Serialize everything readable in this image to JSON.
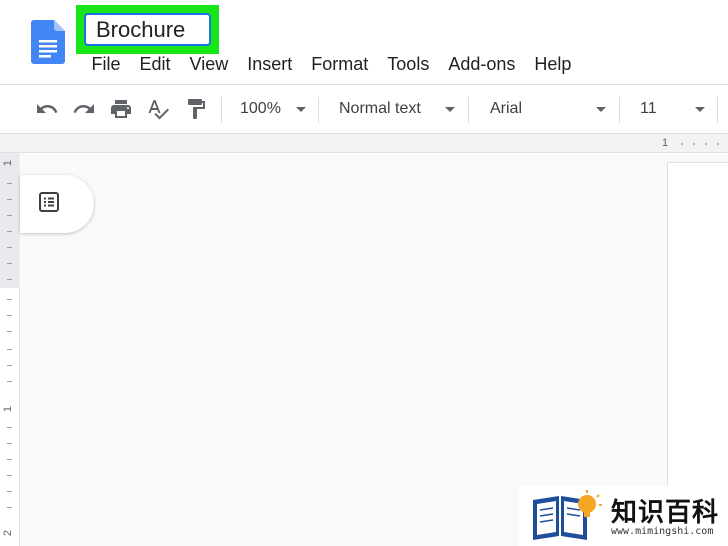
{
  "document": {
    "title": "Brochure"
  },
  "menu": {
    "items": [
      "File",
      "Edit",
      "View",
      "Insert",
      "Format",
      "Tools",
      "Add-ons",
      "Help"
    ]
  },
  "toolbar": {
    "zoom": "100%",
    "style": "Normal text",
    "font": "Arial",
    "font_size": "11"
  },
  "ruler": {
    "horizontal_number": "1",
    "vertical_numbers": [
      "1",
      "1",
      "2"
    ]
  },
  "watermark": {
    "title": "知识百科",
    "url": "www.mimingshi.com"
  },
  "colors": {
    "highlight": "#19e619",
    "title_border": "#1a73e8",
    "docs_blue": "#4285f4"
  },
  "icons": [
    "docs-logo-icon",
    "undo-icon",
    "redo-icon",
    "print-icon",
    "spellcheck-icon",
    "paint-format-icon",
    "outline-icon",
    "chevron-down-icon"
  ]
}
